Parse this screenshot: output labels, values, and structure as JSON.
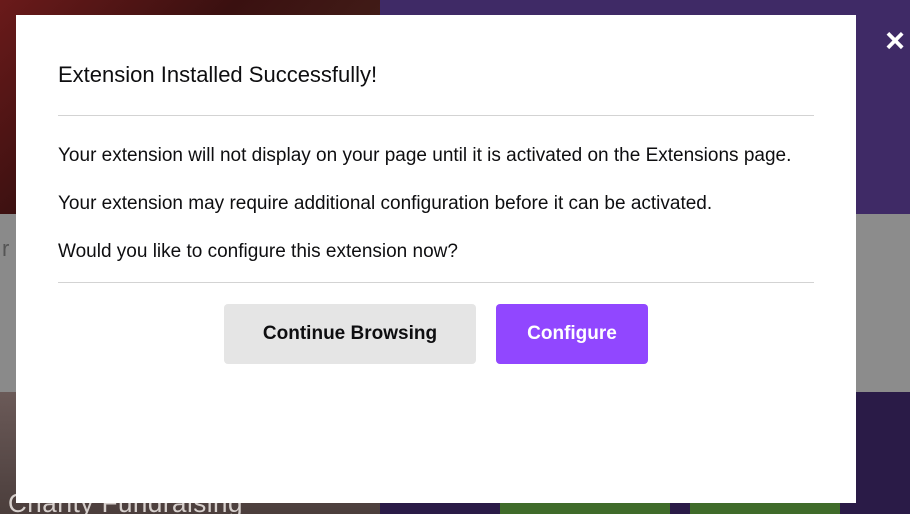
{
  "background": {
    "caption": "Charity Fundraising",
    "edge_char": "r"
  },
  "close_icon": "close-icon",
  "modal": {
    "title": "Extension Installed Successfully!",
    "paragraphs": [
      "Your extension will not display on your page until it is activated on the Extensions page.",
      "Your extension may require additional configuration before it can be activated.",
      "Would you like to configure this extension now?"
    ],
    "buttons": {
      "continue_label": "Continue Browsing",
      "configure_label": "Configure"
    }
  },
  "colors": {
    "primary": "#9147ff",
    "secondary": "#e5e5e5",
    "text": "#0e0e10"
  }
}
